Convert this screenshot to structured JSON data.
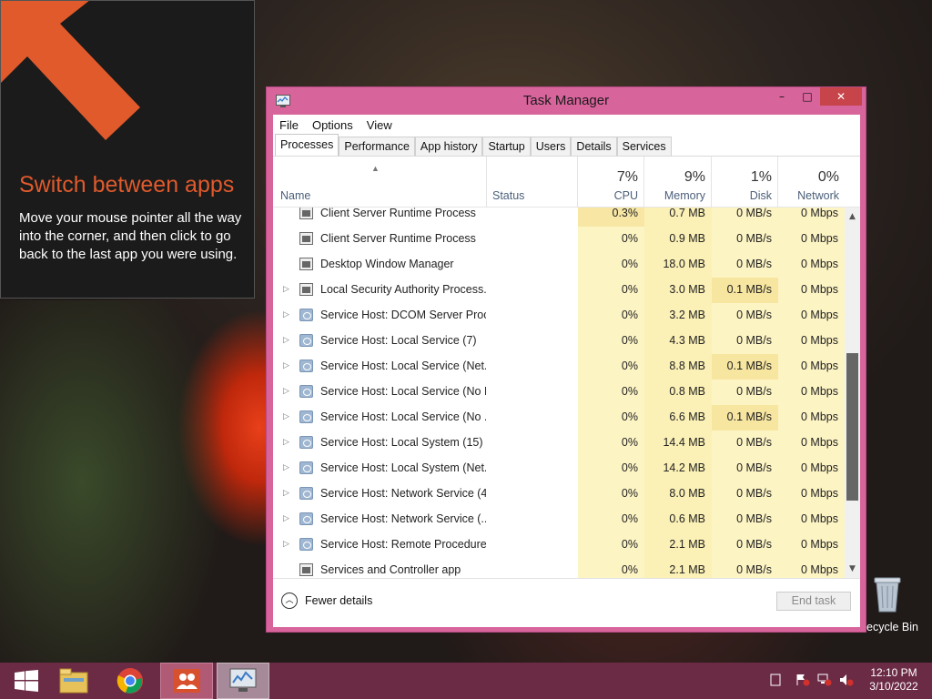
{
  "tip": {
    "title": "Switch between apps",
    "body": "Move your mouse pointer all the way into the corner, and then click to go back to the last app you were using."
  },
  "window": {
    "title": "Task Manager",
    "controls": {
      "minimize": "–",
      "maximize": "□",
      "close": "✕"
    }
  },
  "menu": [
    "File",
    "Options",
    "View"
  ],
  "tabs": [
    "Processes",
    "Performance",
    "App history",
    "Startup",
    "Users",
    "Details",
    "Services"
  ],
  "active_tab": "Processes",
  "columns": {
    "name": "Name",
    "status": "Status",
    "cpu": {
      "pct": "7%",
      "label": "CPU"
    },
    "memory": {
      "pct": "9%",
      "label": "Memory"
    },
    "disk": {
      "pct": "1%",
      "label": "Disk"
    },
    "network": {
      "pct": "0%",
      "label": "Network"
    }
  },
  "processes": [
    {
      "name": "Client Server Runtime Process",
      "expandable": false,
      "icon": "window-icon",
      "cpu": "0.3%",
      "memory": "0.7 MB",
      "disk": "0 MB/s",
      "network": "0 Mbps"
    },
    {
      "name": "Client Server Runtime Process",
      "expandable": false,
      "icon": "window-icon",
      "cpu": "0%",
      "memory": "0.9 MB",
      "disk": "0 MB/s",
      "network": "0 Mbps"
    },
    {
      "name": "Desktop Window Manager",
      "expandable": false,
      "icon": "window-icon",
      "cpu": "0%",
      "memory": "18.0 MB",
      "disk": "0 MB/s",
      "network": "0 Mbps"
    },
    {
      "name": "Local Security Authority Process...",
      "expandable": true,
      "icon": "window-icon",
      "cpu": "0%",
      "memory": "3.0 MB",
      "disk": "0.1 MB/s",
      "network": "0 Mbps"
    },
    {
      "name": "Service Host: DCOM Server Proc...",
      "expandable": true,
      "icon": "gear-icon",
      "cpu": "0%",
      "memory": "3.2 MB",
      "disk": "0 MB/s",
      "network": "0 Mbps"
    },
    {
      "name": "Service Host: Local Service (7)",
      "expandable": true,
      "icon": "gear-icon",
      "cpu": "0%",
      "memory": "4.3 MB",
      "disk": "0 MB/s",
      "network": "0 Mbps"
    },
    {
      "name": "Service Host: Local Service (Net...",
      "expandable": true,
      "icon": "gear-icon",
      "cpu": "0%",
      "memory": "8.8 MB",
      "disk": "0.1 MB/s",
      "network": "0 Mbps"
    },
    {
      "name": "Service Host: Local Service (No I...",
      "expandable": true,
      "icon": "gear-icon",
      "cpu": "0%",
      "memory": "0.8 MB",
      "disk": "0 MB/s",
      "network": "0 Mbps"
    },
    {
      "name": "Service Host: Local Service (No ...",
      "expandable": true,
      "icon": "gear-icon",
      "cpu": "0%",
      "memory": "6.6 MB",
      "disk": "0.1 MB/s",
      "network": "0 Mbps"
    },
    {
      "name": "Service Host: Local System (15)",
      "expandable": true,
      "icon": "gear-icon",
      "cpu": "0%",
      "memory": "14.4 MB",
      "disk": "0 MB/s",
      "network": "0 Mbps"
    },
    {
      "name": "Service Host: Local System (Net...",
      "expandable": true,
      "icon": "gear-icon",
      "cpu": "0%",
      "memory": "14.2 MB",
      "disk": "0 MB/s",
      "network": "0 Mbps"
    },
    {
      "name": "Service Host: Network Service (4)",
      "expandable": true,
      "icon": "gear-icon",
      "cpu": "0%",
      "memory": "8.0 MB",
      "disk": "0 MB/s",
      "network": "0 Mbps"
    },
    {
      "name": "Service Host: Network Service (...",
      "expandable": true,
      "icon": "gear-icon",
      "cpu": "0%",
      "memory": "0.6 MB",
      "disk": "0 MB/s",
      "network": "0 Mbps"
    },
    {
      "name": "Service Host: Remote Procedure...",
      "expandable": true,
      "icon": "gear-icon",
      "cpu": "0%",
      "memory": "2.1 MB",
      "disk": "0 MB/s",
      "network": "0 Mbps"
    },
    {
      "name": "Services and Controller app",
      "expandable": false,
      "icon": "window-icon",
      "cpu": "0%",
      "memory": "2.1 MB",
      "disk": "0 MB/s",
      "network": "0 Mbps"
    }
  ],
  "footer": {
    "fewer_details": "Fewer details",
    "end_task": "End task"
  },
  "desktop": {
    "recycle_bin": "ecycle Bin"
  },
  "taskbar": {
    "items": [
      "windows-start-icon",
      "file-explorer-icon",
      "chrome-icon",
      "people-app-icon",
      "task-manager-icon"
    ],
    "clock_time": "12:10 PM",
    "clock_date": "3/10/2022"
  },
  "colors": {
    "window_frame": "#d8649c",
    "taskbar": "#6c2b45",
    "tip_accent": "#e05a2c",
    "heat_light": "#fdf4c4",
    "heat_mid": "#f7e6a0"
  }
}
